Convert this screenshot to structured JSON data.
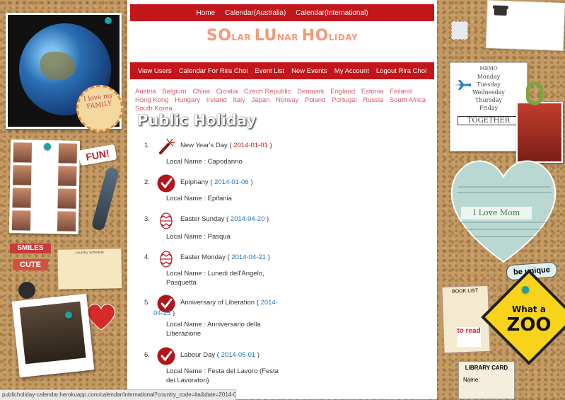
{
  "top_nav": [
    "Home",
    "Calendar(Australia)",
    "Calendar(International)"
  ],
  "logo": {
    "parts": [
      {
        "big": "SO",
        "small": "LAR "
      },
      {
        "big": "LU",
        "small": "NAR "
      },
      {
        "big": "HO",
        "small": "LIDAY"
      }
    ]
  },
  "sub_nav": [
    "View Users",
    "Calendar For Rira Choi",
    "Event List",
    "New Events",
    "My Account",
    "Logout Rira Choi"
  ],
  "countries": [
    "Austria",
    "Belgium",
    "China",
    "Croatia",
    "Czech Republic",
    "Denmark",
    "England",
    "Estonia",
    "Finland",
    "Hong Kong",
    "Hungary",
    "Ireland",
    "Italy",
    "Japan",
    "Norway",
    "Poland",
    "Portugal",
    "Russia",
    "South Africa",
    "South Korea"
  ],
  "page_title": "Public Holiday",
  "holidays": [
    {
      "num": "1.",
      "name": "New Year's Day",
      "date": "2014-01-01",
      "local": "Local Name : Capodanno",
      "icon": "firework-icon",
      "date_color": "#c2161b"
    },
    {
      "num": "2.",
      "name": "Epiphany",
      "date": "2014-01-06",
      "local": "Local Name : Epifania",
      "icon": "checkmark-icon",
      "date_color": "#1d73b8"
    },
    {
      "num": "3.",
      "name": "Easter Sunday",
      "date": "2014-04-20",
      "local": "Local Name : Pasqua",
      "icon": "easter-egg-icon",
      "date_color": "#1d73b8"
    },
    {
      "num": "4.",
      "name": "Easter Monday",
      "date": "2014-04-21",
      "local": "Local Name : Lunedi dell'Angelo, Pasquetta",
      "icon": "easter-egg-icon",
      "date_color": "#1d73b8"
    },
    {
      "num": "5.",
      "name": "Anniversary of Liberation",
      "date": "2014-04-25",
      "local": "Local Name : Anniversario della Liberazione",
      "icon": "checkmark-icon",
      "date_color": "#1d73b8"
    },
    {
      "num": "6.",
      "name": "Labour Day",
      "date": "2014-05-01",
      "local": "Local Name : Festa del Lavoro (Festa dei Lavoratori)",
      "icon": "checkmark-icon",
      "date_color": "#1d73b8"
    }
  ],
  "status_bar": "publicholiday-calendar.herokuapp.com/calendar/international?country_code=ita&date=2014-01-01",
  "decor": {
    "family_badge": "I love my FAMILY",
    "fun": "FUN!",
    "smiles": "SMILES",
    "cute": "CUTE",
    "schedule_title": "Laundry Schedule",
    "memo_title": "MEMO",
    "memo_days": [
      "Monday",
      "Tuesday",
      "Wednesday",
      "Thursday",
      "Friday"
    ],
    "together": "TOGETHER",
    "i_love_mom": "I Love Mom",
    "be_unique": "be unique",
    "book_list": "BOOK LIST",
    "to_read": "to read",
    "what_a": "What a",
    "zoo": "ZOO",
    "library_card": "LIBRARY CARD",
    "name_label": "Name:"
  },
  "colors": {
    "nav_red": "#c2161b",
    "country_link": "#d65a6d",
    "date_link": "#1d73b8",
    "logo": "#f29a7c"
  }
}
